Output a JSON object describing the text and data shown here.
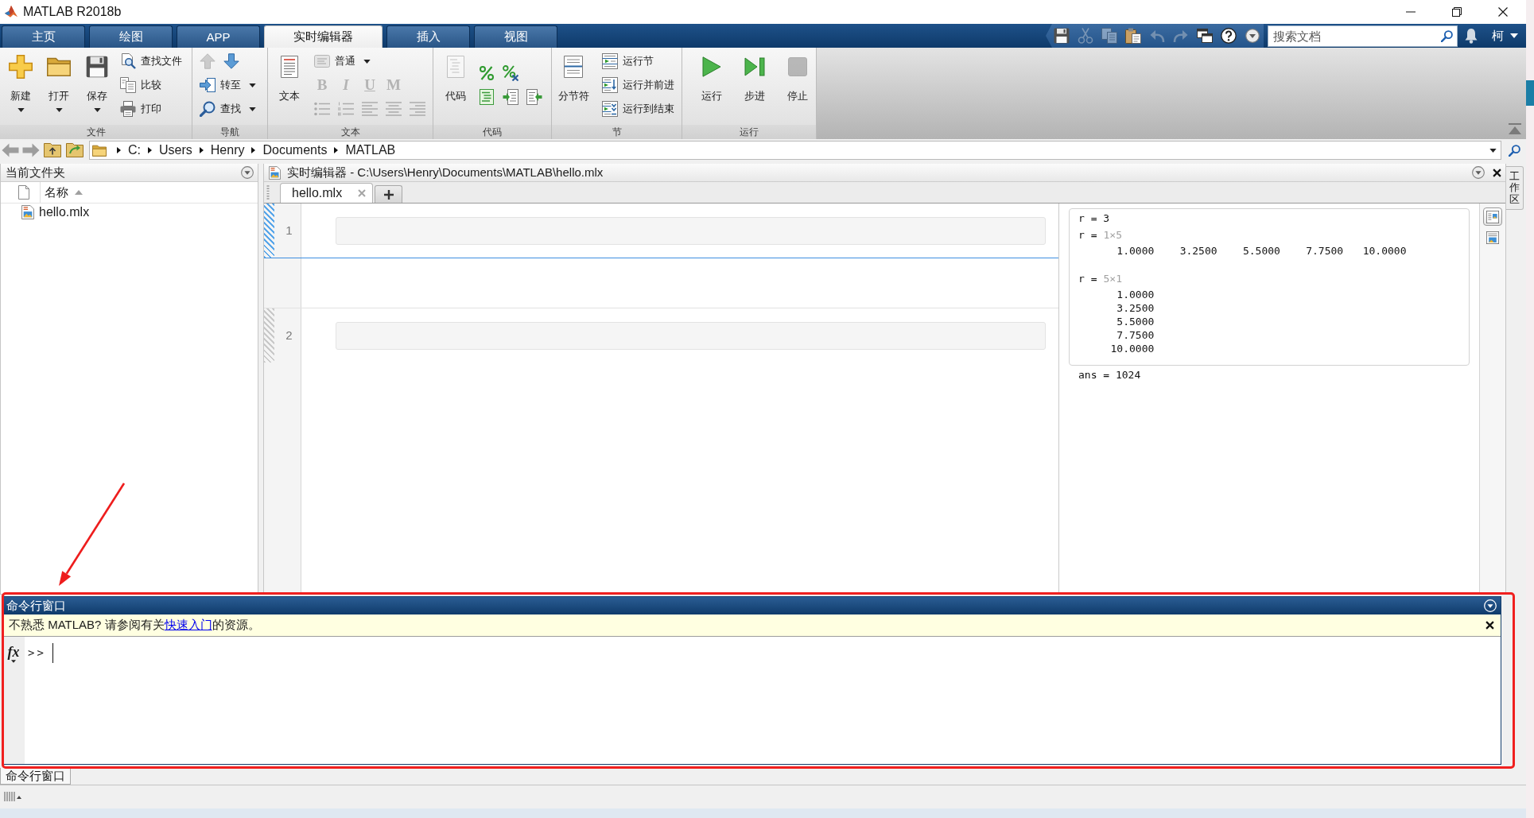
{
  "window": {
    "title": "MATLAB R2018b"
  },
  "ribbon_tabs": [
    {
      "label": "主页",
      "selected": false
    },
    {
      "label": "绘图",
      "selected": false
    },
    {
      "label": "APP",
      "selected": false
    },
    {
      "label": "实时编辑器",
      "selected": true
    },
    {
      "label": "插入",
      "selected": false
    },
    {
      "label": "视图",
      "selected": false
    }
  ],
  "quick_access": {
    "buttons": [
      {
        "disabled": false
      },
      {
        "disabled": true
      },
      {
        "disabled": true
      },
      {
        "disabled": false
      },
      {
        "disabled": true
      },
      {
        "disabled": true
      },
      {
        "disabled": false
      },
      {
        "disabled": false
      },
      {
        "disabled": false
      }
    ],
    "search": {
      "placeholder": "搜索文档"
    },
    "user": "柯"
  },
  "ribbon_groups": [
    {
      "label": "文件",
      "columns": [
        {
          "kind": "large",
          "label": "新建",
          "dropdown": true,
          "disabled": false
        },
        {
          "kind": "large",
          "label": "打开",
          "dropdown": true,
          "disabled": false
        },
        {
          "kind": "large",
          "label": "保存",
          "dropdown": true,
          "disabled": false
        },
        {
          "kind": "stack",
          "lines": [
            {
              "controls": [
                {
                  "kind": "small",
                  "label": "查找文件",
                  "dropdown": false,
                  "disabled": false
                }
              ]
            },
            {
              "controls": [
                {
                  "kind": "small",
                  "label": "比较",
                  "dropdown": false,
                  "disabled": false
                }
              ]
            },
            {
              "controls": [
                {
                  "kind": "small",
                  "label": "打印",
                  "dropdown": false,
                  "disabled": false
                }
              ]
            }
          ]
        }
      ]
    },
    {
      "label": "导航",
      "columns": [
        {
          "kind": "stack",
          "lines": [
            {
              "controls": [
                {
                  "kind": "icon",
                  "disabled": true
                },
                {
                  "kind": "icon",
                  "disabled": false
                }
              ]
            },
            {
              "controls": [
                {
                  "kind": "small",
                  "label": "转至",
                  "dropdown": true,
                  "disabled": false
                }
              ]
            },
            {
              "controls": [
                {
                  "kind": "small",
                  "label": "查找",
                  "dropdown": true,
                  "disabled": false
                }
              ]
            }
          ]
        }
      ]
    },
    {
      "label": "文本",
      "columns": [
        {
          "kind": "large",
          "label": "文本",
          "dropdown": false,
          "disabled": false
        },
        {
          "kind": "stack",
          "lines": [
            {
              "controls": [
                {
                  "kind": "small",
                  "label": "普通",
                  "dropdown": true,
                  "disabled": false
                }
              ]
            },
            {
              "controls": [
                {
                  "kind": "glyph",
                  "label": "B",
                  "disabled": true
                },
                {
                  "kind": "glyph",
                  "label": "I",
                  "disabled": true
                },
                {
                  "kind": "glyph",
                  "label": "U",
                  "disabled": true
                },
                {
                  "kind": "glyph",
                  "label": "M",
                  "disabled": true
                }
              ]
            },
            {
              "controls": [
                {
                  "kind": "icon",
                  "disabled": true
                },
                {
                  "kind": "icon",
                  "disabled": true
                },
                {
                  "kind": "icon",
                  "disabled": true
                },
                {
                  "kind": "icon",
                  "disabled": true
                },
                {
                  "kind": "icon",
                  "disabled": true
                }
              ]
            }
          ]
        }
      ]
    },
    {
      "label": "代码",
      "columns": [
        {
          "kind": "large",
          "label": "代码",
          "dropdown": false,
          "disabled": true
        },
        {
          "kind": "stack",
          "lines": [
            {
              "controls": [
                {
                  "kind": "icon",
                  "disabled": false
                },
                {
                  "kind": "icon",
                  "disabled": false
                }
              ]
            },
            {
              "controls": [
                {
                  "kind": "icon",
                  "disabled": false
                },
                {
                  "kind": "icon",
                  "disabled": false
                },
                {
                  "kind": "icon",
                  "disabled": false
                }
              ]
            }
          ]
        }
      ]
    },
    {
      "label": "节",
      "columns": [
        {
          "kind": "large",
          "label": "分节符",
          "dropdown": false,
          "disabled": false
        },
        {
          "kind": "stack",
          "lines": [
            {
              "controls": [
                {
                  "kind": "small",
                  "label": "运行节",
                  "dropdown": false,
                  "disabled": false
                }
              ]
            },
            {
              "controls": [
                {
                  "kind": "small",
                  "label": "运行并前进",
                  "dropdown": false,
                  "disabled": false
                }
              ]
            },
            {
              "controls": [
                {
                  "kind": "small",
                  "label": "运行到结束",
                  "dropdown": false,
                  "disabled": false
                }
              ]
            }
          ]
        }
      ]
    },
    {
      "label": "运行",
      "columns": [
        {
          "kind": "large",
          "label": "运行",
          "dropdown": false,
          "disabled": false
        },
        {
          "kind": "large",
          "label": "步进",
          "dropdown": false,
          "disabled": false
        },
        {
          "kind": "large",
          "label": "停止",
          "dropdown": false,
          "disabled": true
        }
      ]
    }
  ],
  "address": {
    "segments": [
      "C:",
      "Users",
      "Henry",
      "Documents",
      "MATLAB"
    ]
  },
  "current_folder": {
    "title": "当前文件夹",
    "name_column": {
      "label": "名称",
      "sorted": true
    },
    "files": [
      {
        "name": "hello.mlx",
        "selected": false
      }
    ]
  },
  "editor": {
    "title": "实时编辑器 - C:\\Users\\Henry\\Documents\\MATLAB\\hello.mlx",
    "tabs": [
      {
        "label": "hello.mlx",
        "selected": true
      }
    ],
    "sections": [
      {
        "selected": true,
        "line_number": "1",
        "outputs": [
          {
            "kind": "scalar",
            "text": "r = 3"
          },
          {
            "kind": "row",
            "label": "r =",
            "size": "1×5",
            "values": [
              "1.0000",
              "3.2500",
              "5.5000",
              "7.7500",
              "10.0000"
            ]
          },
          {
            "kind": "column",
            "label": "r =",
            "size": "5×1",
            "values": [
              "1.0000",
              "3.2500",
              "5.5000",
              "7.7500",
              "10.0000"
            ]
          }
        ]
      },
      {
        "selected": false,
        "line_number": "2",
        "outputs": [
          {
            "kind": "scalar",
            "text": "ans = 1024"
          }
        ]
      }
    ],
    "output_modes": [
      {
        "selected": true
      },
      {
        "selected": false
      }
    ]
  },
  "workspace_tab": "工作区",
  "command_window": {
    "title": "命令行窗口",
    "notice": {
      "before": "不熟悉 MATLAB? 请参阅有关",
      "link": "快速入门",
      "after": "的资源。"
    },
    "function_button": "fx",
    "prompt": ">>"
  },
  "minimized_tabs": [
    "命令行窗口"
  ],
  "annotations": {
    "frame": true,
    "arrow": true
  }
}
